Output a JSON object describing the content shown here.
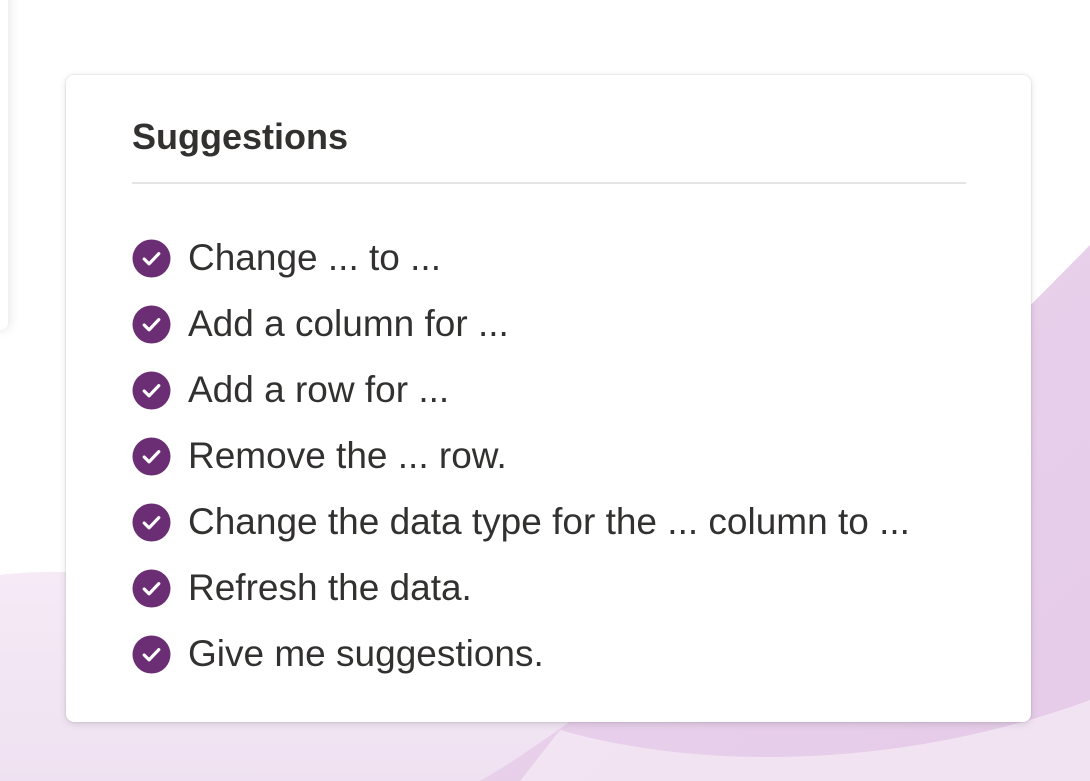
{
  "colors": {
    "accent": "#6b2d73",
    "background_wash": "#ecd7ee",
    "text": "#323130",
    "divider": "#e6e4e6",
    "card": "#ffffff"
  },
  "card": {
    "title": "Suggestions",
    "items": [
      {
        "label": "Change ... to ...",
        "icon": "check-circle-icon"
      },
      {
        "label": "Add a column for ...",
        "icon": "check-circle-icon"
      },
      {
        "label": "Add a row for ...",
        "icon": "check-circle-icon"
      },
      {
        "label": "Remove the ... row.",
        "icon": "check-circle-icon"
      },
      {
        "label": "Change the data type for the ... column to ...",
        "icon": "check-circle-icon"
      },
      {
        "label": "Refresh the data.",
        "icon": "check-circle-icon"
      },
      {
        "label": "Give me suggestions.",
        "icon": "check-circle-icon"
      }
    ]
  }
}
